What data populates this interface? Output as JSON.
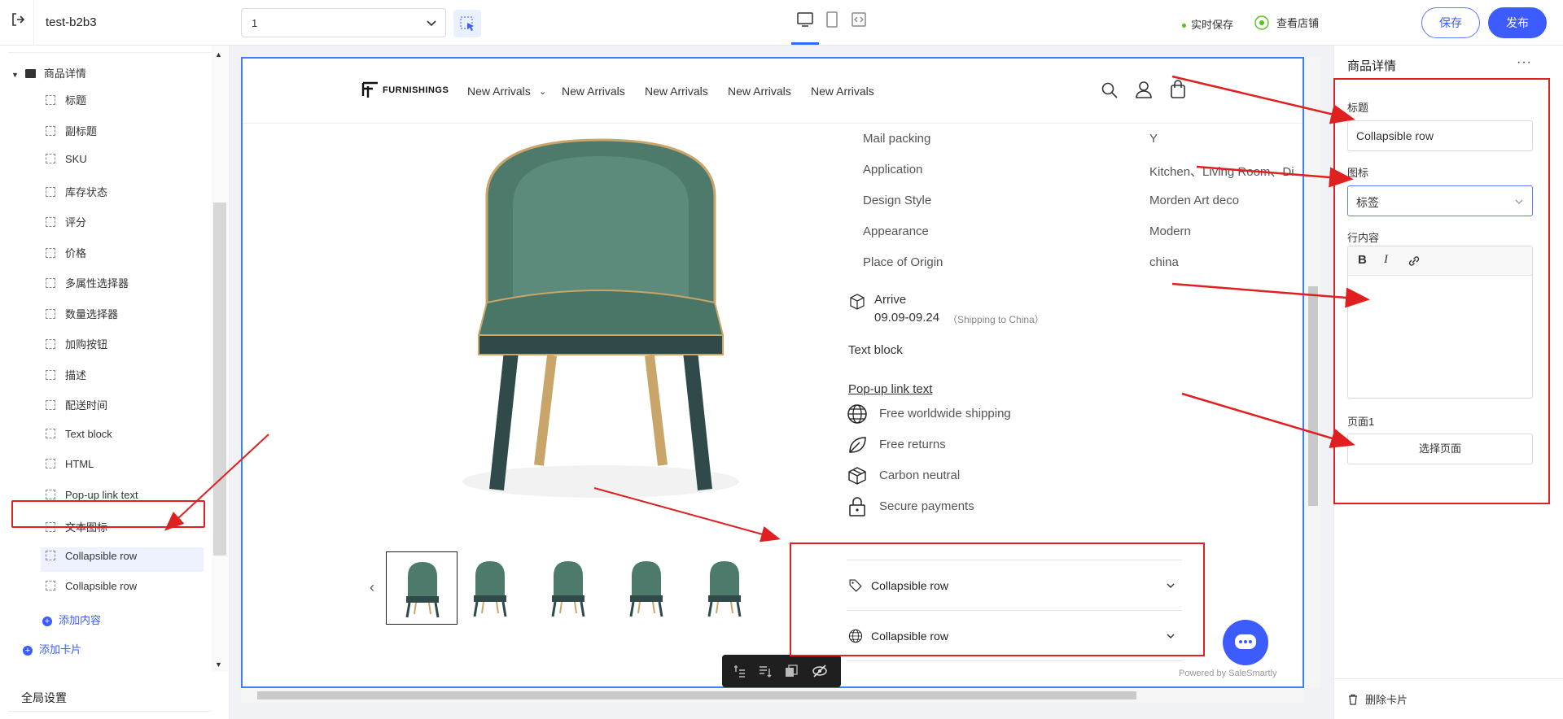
{
  "topbar": {
    "site_name": "test-b2b3",
    "page_select_value": "1",
    "autosave_label": "实时保存",
    "view_store_label": "查看店铺",
    "save_label": "保存",
    "publish_label": "发布"
  },
  "sidebar": {
    "section_title": "商品详情",
    "items": [
      {
        "label": "标题"
      },
      {
        "label": "副标题"
      },
      {
        "label": "SKU"
      },
      {
        "label": "库存状态"
      },
      {
        "label": "评分"
      },
      {
        "label": "价格"
      },
      {
        "label": "多属性选择器"
      },
      {
        "label": "数量选择器"
      },
      {
        "label": "加购按钮"
      },
      {
        "label": "描述"
      },
      {
        "label": "配送时间"
      },
      {
        "label": "Text block"
      },
      {
        "label": "HTML"
      },
      {
        "label": "Pop-up link text"
      },
      {
        "label": "文本图标"
      },
      {
        "label": "Collapsible row"
      },
      {
        "label": "Collapsible row"
      }
    ],
    "add_content_label": "添加内容",
    "add_card_label": "添加卡片",
    "global_settings_label": "全局设置"
  },
  "preview": {
    "logo_text": "FURNISHINGS",
    "nav_links": [
      "New Arrivals",
      "New Arrivals",
      "New Arrivals",
      "New Arrivals",
      "New Arrivals"
    ],
    "specs": [
      {
        "key": "Mail packing",
        "value": "Y"
      },
      {
        "key": "Application",
        "value": "Kitchen、Living Room、Di"
      },
      {
        "key": "Design Style",
        "value": "Morden Art deco"
      },
      {
        "key": "Appearance",
        "value": "Modern"
      },
      {
        "key": "Place of Origin",
        "value": "china"
      }
    ],
    "arrive_label": "Arrive",
    "arrive_date": "09.09-09.24",
    "arrive_note": "（Shipping to China）",
    "text_block": "Text block",
    "popup_link": "Pop-up link text",
    "perks": [
      {
        "icon": "globe-icon",
        "label": "Free worldwide shipping"
      },
      {
        "icon": "leaf-icon",
        "label": "Free returns"
      },
      {
        "icon": "box-icon",
        "label": "Carbon neutral"
      },
      {
        "icon": "lock-icon",
        "label": "Secure payments"
      }
    ],
    "collapsible_rows": [
      {
        "icon": "tag-icon",
        "label": "Collapsible row"
      },
      {
        "icon": "globe-icon",
        "label": "Collapsible row"
      }
    ],
    "prev_arrow": "‹",
    "powered_by": "Powered by SaleSmartly"
  },
  "right_panel": {
    "title": "商品详情",
    "more": "···",
    "title_label": "标题",
    "title_value": "Collapsible row",
    "icon_label": "图标",
    "icon_value": "标签",
    "row_content_label": "行内容",
    "bold": "B",
    "italic": "I",
    "page_label": "页面1",
    "pick_page_label": "选择页面",
    "delete_card_label": "删除卡片"
  },
  "colors": {
    "accent": "#3d5cff",
    "highlight": "#e02020",
    "canvas_border": "#3b7ff5",
    "chair_green": "#4d7a6b"
  }
}
